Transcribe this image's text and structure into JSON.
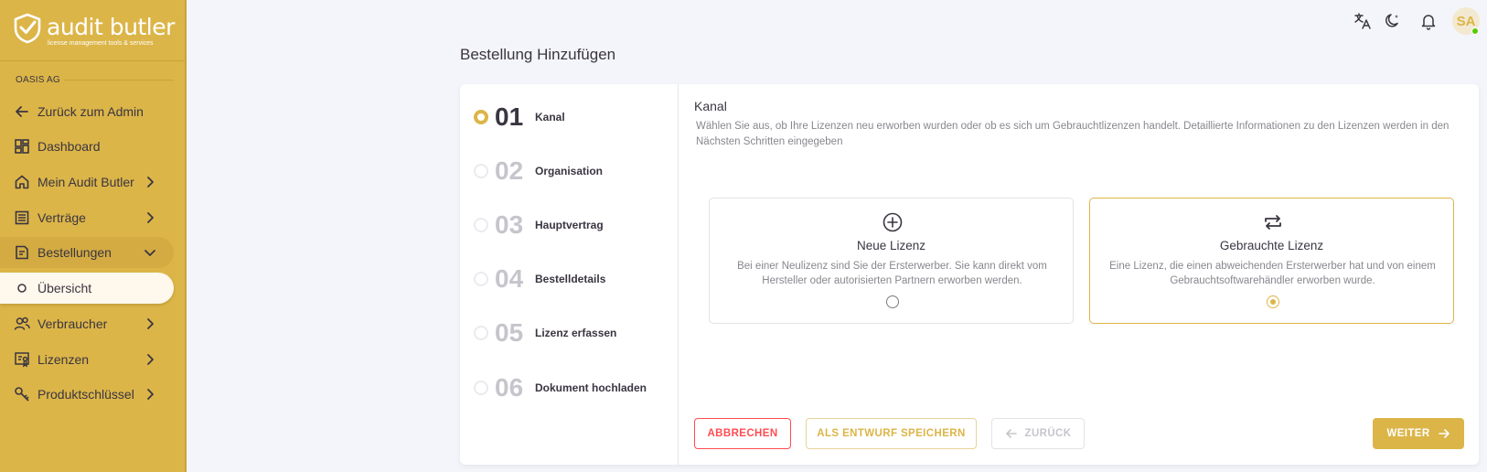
{
  "brand": {
    "name": "audit butler",
    "tagline": "license management tools & services",
    "accent": "#dcb548"
  },
  "sidebar": {
    "org": "OASIS AG",
    "items": [
      {
        "label": "Zurück zum Admin",
        "icon": "arrow-left-icon"
      },
      {
        "label": "Dashboard",
        "icon": "dashboard-icon"
      },
      {
        "label": "Mein Audit Butler",
        "icon": "home-icon"
      },
      {
        "label": "Verträge",
        "icon": "contracts-icon"
      },
      {
        "label": "Bestellungen",
        "icon": "orders-icon"
      },
      {
        "label": "Übersicht",
        "icon": "circle-outline-icon"
      },
      {
        "label": "Verbraucher",
        "icon": "users-icon"
      },
      {
        "label": "Lizenzen",
        "icon": "license-icon"
      },
      {
        "label": "Produktschlüssel",
        "icon": "key-icon"
      }
    ]
  },
  "topbar": {
    "avatar_initials": "SA",
    "icons": [
      "translate-icon",
      "moon-icon",
      "bell-icon"
    ]
  },
  "page": {
    "title": "Bestellung Hinzufügen"
  },
  "steps": [
    {
      "num": "01",
      "label": "Kanal"
    },
    {
      "num": "02",
      "label": "Organisation"
    },
    {
      "num": "03",
      "label": "Hauptvertrag"
    },
    {
      "num": "04",
      "label": "Bestelldetails"
    },
    {
      "num": "05",
      "label": "Lizenz erfassen"
    },
    {
      "num": "06",
      "label": "Dokument hochladen"
    }
  ],
  "content": {
    "title": "Kanal",
    "description": "Wählen Sie aus, ob Ihre Lizenzen neu erworben wurden oder ob es sich um Gebrauchtlizenzen handelt. Detaillierte Informationen zu den Lizenzen werden in den Nächsten Schritten eingegeben",
    "options": [
      {
        "title": "Neue Lizenz",
        "description": "Bei einer Neulizenz sind Sie der Ersterwerber. Sie kann direkt vom Hersteller oder autorisierten Partnern erworben werden.",
        "selected": false
      },
      {
        "title": "Gebrauchte Lizenz",
        "description": "Eine Lizenz, die einen abweichenden Ersterwerber hat und von einem Gebrauchtsoftwarehändler erworben wurde.",
        "selected": true
      }
    ]
  },
  "buttons": {
    "cancel": "ABBRECHEN",
    "draft": "ALS ENTWURF SPEICHERN",
    "back": "ZURÜCK",
    "next": "WEITER"
  }
}
